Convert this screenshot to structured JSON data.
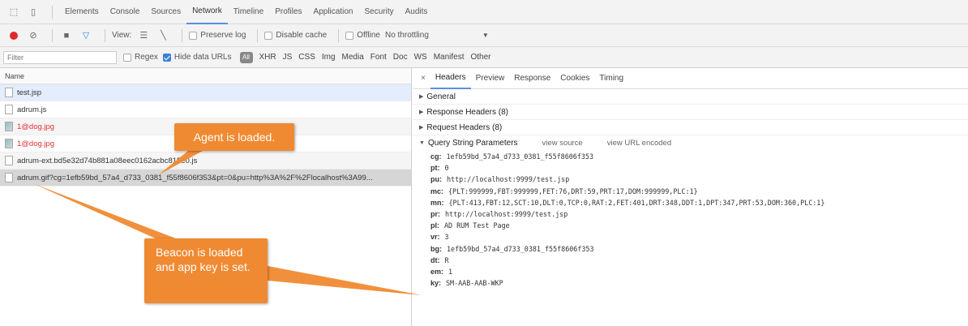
{
  "devtools_tabs": [
    "Elements",
    "Console",
    "Sources",
    "Network",
    "Timeline",
    "Profiles",
    "Application",
    "Security",
    "Audits"
  ],
  "toolbar": {
    "view_label": "View:",
    "preserve_log": "Preserve log",
    "disable_cache": "Disable cache",
    "offline": "Offline",
    "throttling": "No throttling"
  },
  "filterbar": {
    "placeholder": "Filter",
    "regex": "Regex",
    "hide_data_urls": "Hide data URLs",
    "all_badge": "All",
    "types": [
      "XHR",
      "JS",
      "CSS",
      "Img",
      "Media",
      "Font",
      "Doc",
      "WS",
      "Manifest",
      "Other"
    ]
  },
  "requests": {
    "header": "Name",
    "items": [
      {
        "name": "test.jsp",
        "error": false,
        "icon": "file-icon"
      },
      {
        "name": "adrum.js",
        "error": false,
        "icon": "file-icon"
      },
      {
        "name": "1@dog.jpg",
        "error": true,
        "icon": "image-icon"
      },
      {
        "name": "1@dog.jpg",
        "error": true,
        "icon": "image-icon"
      },
      {
        "name": "adrum-ext.bd5e32d74b881a08eec0162acbc815e0.js",
        "error": false,
        "icon": "file-icon"
      },
      {
        "name": "adrum.gif?cg=1efb59bd_57a4_d733_0381_f55f8606f353&pt=0&pu=http%3A%2F%2Flocalhost%3A99...",
        "error": false,
        "icon": "file-icon"
      }
    ]
  },
  "detail": {
    "close": "×",
    "tabs": [
      "Headers",
      "Preview",
      "Response",
      "Cookies",
      "Timing"
    ],
    "sections": {
      "general": "General",
      "response_headers": "Response Headers (8)",
      "request_headers": "Request Headers (8)",
      "query": "Query String Parameters",
      "view_source": "view source",
      "view_encoded": "view URL encoded"
    },
    "params": [
      {
        "k": "cg:",
        "v": "1efb59bd_57a4_d733_0381_f55f8606f353"
      },
      {
        "k": "pt:",
        "v": "0"
      },
      {
        "k": "pu:",
        "v": "http://localhost:9999/test.jsp"
      },
      {
        "k": "mc:",
        "v": "{PLT:999999,FBT:999999,FET:76,DRT:59,PRT:17,DOM:999999,PLC:1}"
      },
      {
        "k": "mn:",
        "v": "{PLT:413,FBT:12,SCT:10,DLT:0,TCP:0,RAT:2,FET:401,DRT:348,DDT:1,DPT:347,PRT:53,DOM:360,PLC:1}"
      },
      {
        "k": "pr:",
        "v": "http://localhost:9999/test.jsp"
      },
      {
        "k": "pl:",
        "v": "AD RUM Test Page"
      },
      {
        "k": "vr:",
        "v": "3"
      },
      {
        "k": "bg:",
        "v": "1efb59bd_57a4_d733_0381_f55f8606f353"
      },
      {
        "k": "dt:",
        "v": "R"
      },
      {
        "k": "em:",
        "v": "1"
      },
      {
        "k": "ky:",
        "v": "SM-AAB-AAB-WKP"
      }
    ]
  },
  "annotations": {
    "agent": "Agent is loaded.",
    "beacon": "Beacon is loaded and app key is set.",
    "color": "#f08a32"
  }
}
